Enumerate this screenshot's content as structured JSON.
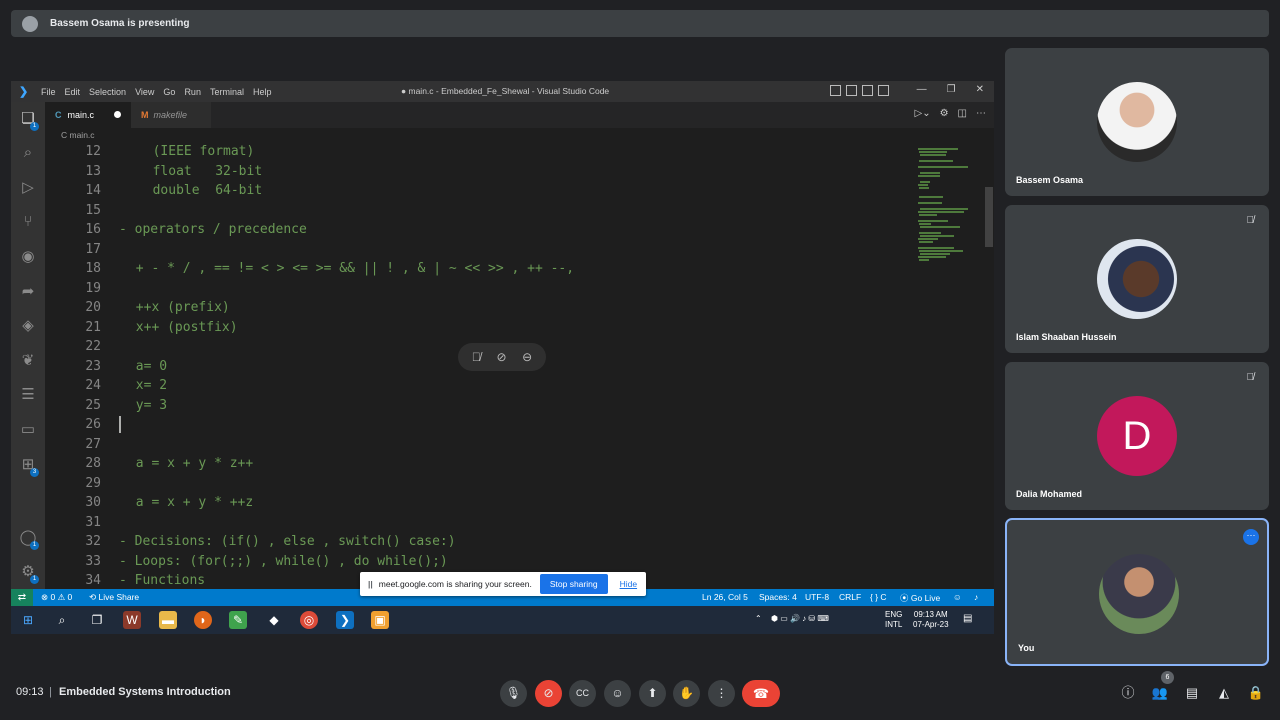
{
  "presenting": {
    "text": "Bassem Osama is presenting"
  },
  "vscode": {
    "menu": [
      "File",
      "Edit",
      "Selection",
      "View",
      "Go",
      "Run",
      "Terminal",
      "Help"
    ],
    "window_title": "● main.c - Embedded_Fe_Shewal - Visual Studio Code",
    "tabs": [
      {
        "icon": "C",
        "label": "main.c"
      },
      {
        "icon": "M",
        "label": "makefile"
      }
    ],
    "breadcrumb": "C main.c",
    "code_lines": [
      {
        "n": "12",
        "text": "(IEEE format)",
        "indent": 4
      },
      {
        "n": "13",
        "text": "float   32-bit",
        "indent": 4
      },
      {
        "n": "14",
        "text": "double  64-bit",
        "indent": 4
      },
      {
        "n": "15",
        "text": "",
        "indent": 0
      },
      {
        "n": "16",
        "text": "- operators / precedence",
        "indent": 0
      },
      {
        "n": "17",
        "text": "",
        "indent": 0
      },
      {
        "n": "18",
        "text": "+ - * / , == != < > <= >= && || ! , & | ~ << >> , ++ --,",
        "indent": 2
      },
      {
        "n": "19",
        "text": "",
        "indent": 0
      },
      {
        "n": "20",
        "text": "++x (prefix)",
        "indent": 2
      },
      {
        "n": "21",
        "text": "x++ (postfix)",
        "indent": 2
      },
      {
        "n": "22",
        "text": "",
        "indent": 0
      },
      {
        "n": "23",
        "text": "a= 0",
        "indent": 2
      },
      {
        "n": "24",
        "text": "x= 2",
        "indent": 2
      },
      {
        "n": "25",
        "text": "y= 3",
        "indent": 2
      },
      {
        "n": "26",
        "text": "",
        "indent": 0
      },
      {
        "n": "27",
        "text": "",
        "indent": 0
      },
      {
        "n": "28",
        "text": "a = x + y * z++",
        "indent": 2
      },
      {
        "n": "29",
        "text": "",
        "indent": 0
      },
      {
        "n": "30",
        "text": "a = x + y * ++z",
        "indent": 2
      },
      {
        "n": "31",
        "text": "",
        "indent": 0
      },
      {
        "n": "32",
        "text": "- Decisions: (if() , else , switch() case:)",
        "indent": 0
      },
      {
        "n": "33",
        "text": "- Loops: (for(;;) , while() , do while();)",
        "indent": 0
      },
      {
        "n": "34",
        "text": "- Functions",
        "indent": 0
      }
    ],
    "status": {
      "errors": "⊗ 0 ⚠ 0",
      "live_share": "Live Share",
      "position": "Ln 26, Col 5",
      "spaces": "Spaces: 4",
      "encoding": "UTF-8",
      "eol": "CRLF",
      "language": "{ } C",
      "go_live": "Go Live"
    },
    "taskbar": {
      "lang": "ENG",
      "layout": "INTL",
      "time": "09:13 AM",
      "date": "07-Apr-23"
    }
  },
  "share_banner": {
    "text": "meet.google.com is sharing your screen.",
    "stop": "Stop sharing",
    "hide": "Hide"
  },
  "participants": [
    {
      "name": "Bassem Osama"
    },
    {
      "name": "Islam Shaaban Hussein"
    },
    {
      "name": "Dalia Mohamed",
      "initial": "D"
    },
    {
      "name": "You"
    }
  ],
  "bottom": {
    "time": "09:13",
    "separator": "|",
    "meeting": "Embedded Systems Introduction",
    "people_count": "6"
  },
  "colors": {
    "code_comment_green": "#6a9955",
    "status_blue": "#007acc",
    "end_call_red": "#ea4335",
    "dalia_avatar": "#c2185b"
  }
}
